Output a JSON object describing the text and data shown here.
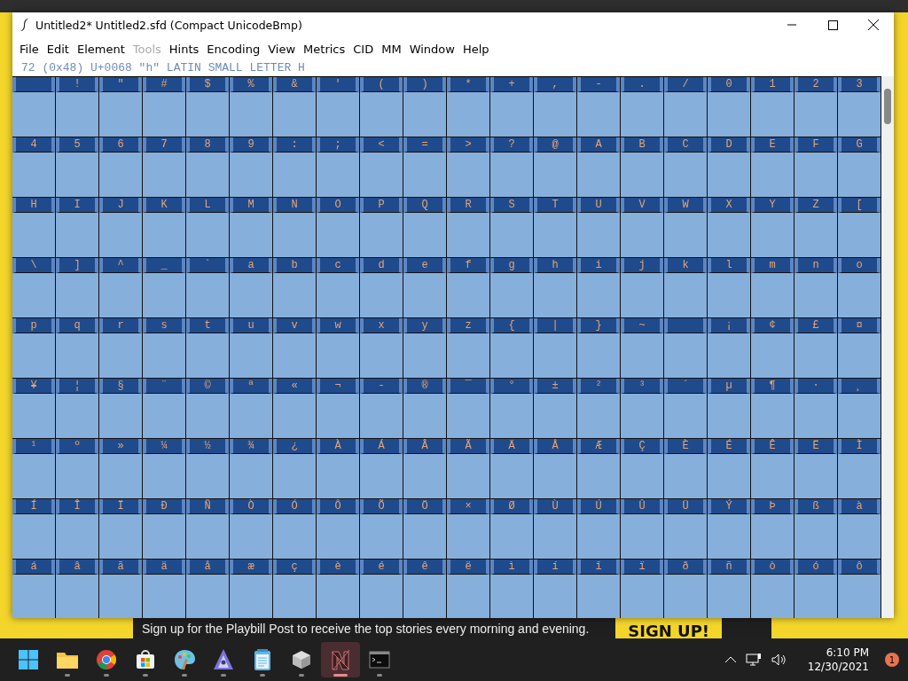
{
  "backdrop": {
    "banner": "Sign up for the Playbill Post to receive the top stories every morning and evening.",
    "banner_button": "SIGN UP!"
  },
  "window": {
    "title": "Untitled2*  Untitled2.sfd (Compact UnicodeBmp)"
  },
  "menu": [
    {
      "label": "File",
      "disabled": false
    },
    {
      "label": "Edit",
      "disabled": false
    },
    {
      "label": "Element",
      "disabled": false
    },
    {
      "label": "Tools",
      "disabled": true
    },
    {
      "label": "Hints",
      "disabled": false
    },
    {
      "label": "Encoding",
      "disabled": false
    },
    {
      "label": "View",
      "disabled": false
    },
    {
      "label": "Metrics",
      "disabled": false
    },
    {
      "label": "CID",
      "disabled": false
    },
    {
      "label": "MM",
      "disabled": false
    },
    {
      "label": "Window",
      "disabled": false
    },
    {
      "label": "Help",
      "disabled": false
    }
  ],
  "info": "72 (0x48) U+0068 \"h\" LATIN SMALL LETTER H",
  "glyph_rows": [
    [
      null,
      "!",
      "\"",
      "#",
      "$",
      "%",
      "&",
      "'",
      "(",
      ")",
      "*",
      "+",
      ",",
      "-",
      ".",
      "/",
      "0",
      "1",
      "2",
      "3"
    ],
    [
      "4",
      "5",
      "6",
      "7",
      "8",
      "9",
      ":",
      ";",
      "<",
      "=",
      ">",
      "?",
      "@",
      "A",
      "B",
      "C",
      "D",
      "E",
      "F",
      "G"
    ],
    [
      "H",
      "I",
      "J",
      "K",
      "L",
      "M",
      "N",
      "O",
      "P",
      "Q",
      "R",
      "S",
      "T",
      "U",
      "V",
      "W",
      "X",
      "Y",
      "Z",
      "["
    ],
    [
      "\\",
      "]",
      "^",
      "_",
      "`",
      "a",
      "b",
      "c",
      "d",
      "e",
      "f",
      "g",
      "h",
      "i",
      "j",
      "k",
      "l",
      "m",
      "n",
      "o"
    ],
    [
      "p",
      "q",
      "r",
      "s",
      "t",
      "u",
      "v",
      "w",
      "x",
      "y",
      "z",
      "{",
      "|",
      "}",
      "~",
      null,
      "¡",
      "¢",
      "£",
      "¤"
    ],
    [
      "¥",
      "¦",
      "§",
      "¨",
      "©",
      "ª",
      "«",
      "¬",
      "-",
      "®",
      "¯",
      "°",
      "±",
      "²",
      "³",
      "´",
      "µ",
      "¶",
      "·",
      "¸"
    ],
    [
      "¹",
      "º",
      "»",
      "¼",
      "½",
      "¾",
      "¿",
      "À",
      "Á",
      "Â",
      "Ã",
      "Ä",
      "Å",
      "Æ",
      "Ç",
      "È",
      "É",
      "Ê",
      "Ë",
      "Ì"
    ],
    [
      "Í",
      "Î",
      "Ï",
      "Ð",
      "Ñ",
      "Ò",
      "Ó",
      "Ô",
      "Õ",
      "Ö",
      "×",
      "Ø",
      "Ù",
      "Ú",
      "Û",
      "Ü",
      "Ý",
      "Þ",
      "ß",
      "à"
    ],
    [
      "á",
      "â",
      "ã",
      "ä",
      "å",
      "æ",
      "ç",
      "è",
      "é",
      "ê",
      "ë",
      "ì",
      "í",
      "î",
      "ï",
      "ð",
      "ñ",
      "ò",
      "ó",
      "ô"
    ]
  ],
  "taskbar": {
    "apps": [
      {
        "kind": "start",
        "active": false
      },
      {
        "kind": "folder",
        "active": false
      },
      {
        "kind": "browser",
        "active": false
      },
      {
        "kind": "store",
        "active": false
      },
      {
        "kind": "paint",
        "active": false
      },
      {
        "kind": "vector",
        "active": false
      },
      {
        "kind": "notepad",
        "active": false
      },
      {
        "kind": "cube",
        "active": false
      },
      {
        "kind": "fontforge",
        "active": true
      },
      {
        "kind": "terminal",
        "active": false
      }
    ],
    "time": "6:10 PM",
    "date": "12/30/2021",
    "notifications": "1"
  }
}
